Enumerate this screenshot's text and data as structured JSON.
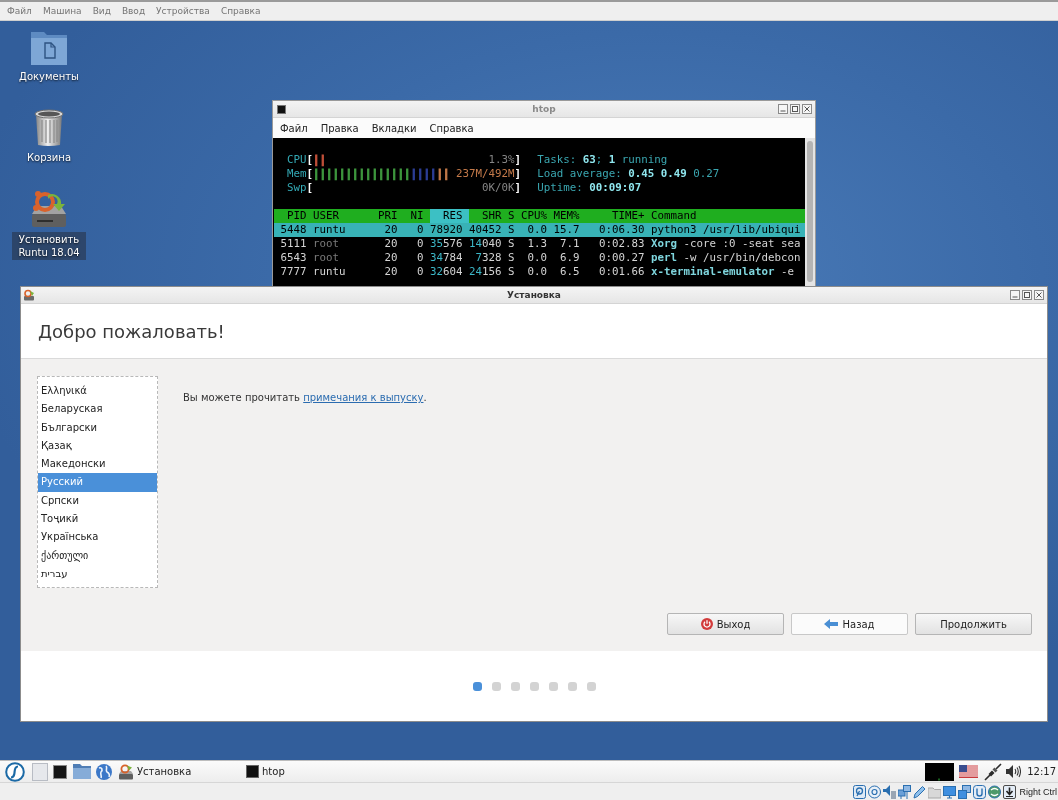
{
  "vm_menu": [
    "Файл",
    "Машина",
    "Вид",
    "Ввод",
    "Устройства",
    "Справка"
  ],
  "desktop_icons": [
    {
      "kind": "folder",
      "label": "Документы",
      "selected": false
    },
    {
      "kind": "trash",
      "label": "Корзина",
      "selected": false
    },
    {
      "kind": "installer",
      "label": "Установить Runtu 18.04",
      "selected": true
    }
  ],
  "htop": {
    "title": "htop",
    "menu": [
      "Файл",
      "Правка",
      "Вкладки",
      "Справка"
    ],
    "meters": [
      {
        "label": "CPU",
        "open": "[",
        "segments": [
          {
            "text": "||",
            "color": "#c4513a"
          }
        ],
        "value": {
          "text": "1.3%",
          "color": "#858585"
        },
        "close": "]"
      },
      {
        "label": "Mem",
        "open": "[",
        "segments": [
          {
            "text": "|||||||||||||||",
            "color": "#3f9a3f"
          },
          {
            "text": "||||",
            "color": "#2d3f99"
          },
          {
            "text": "||",
            "color": "#c47a4a"
          }
        ],
        "value": {
          "text": "237M/492M",
          "color": "#c47a4a"
        },
        "close": "]"
      },
      {
        "label": "Swp",
        "open": "[",
        "value": {
          "text": "0K/0K",
          "color": "#858585"
        },
        "close": "]"
      }
    ],
    "summary": [
      "Tasks: **63**; **1** running",
      "Load average: **0.45** **0.49** 0.27",
      "Uptime: **00:09:07**"
    ],
    "columns": [
      {
        "label": "PID",
        "selected": false
      },
      {
        "label": "USER",
        "selected": false
      },
      {
        "label": "PRI",
        "selected": false
      },
      {
        "label": "NI",
        "selected": false
      },
      {
        "label": "RES",
        "selected": true
      },
      {
        "label": "SHR",
        "selected": false
      },
      {
        "label": "S",
        "selected": false
      },
      {
        "label": "CPU%",
        "selected": false
      },
      {
        "label": "MEM%",
        "selected": false
      },
      {
        "label": "TIME+",
        "selected": false
      },
      {
        "label": "Command",
        "selected": false
      }
    ],
    "rows": [
      {
        "cells": [
          "5448",
          "runtu",
          "20",
          "0",
          "78920",
          "40452",
          "S",
          "0.0",
          "15.7",
          "0:06.30",
          "python3 /usr/lib/ubiqui"
        ],
        "user_muted": false,
        "selected": true
      },
      {
        "cells": [
          "5111",
          "root",
          "20",
          "0",
          "35576",
          "14040",
          "S",
          "1.3",
          "7.1",
          "0:02.83",
          "Xorg -core :0 -seat sea"
        ],
        "user_muted": true,
        "selected": false
      },
      {
        "cells": [
          "6543",
          "root",
          "20",
          "0",
          "34784",
          "7328",
          "S",
          "0.0",
          "6.9",
          "0:00.27",
          "perl -w /usr/bin/debcon"
        ],
        "user_muted": true,
        "selected": false
      },
      {
        "cells": [
          "7777",
          "runtu",
          "20",
          "0",
          "32604",
          "24156",
          "S",
          "0.0",
          "6.5",
          "0:01.66",
          "x-terminal-emulator -e"
        ],
        "user_muted": false,
        "selected": false
      }
    ]
  },
  "installer": {
    "title": "Установка",
    "heading": "Добро пожаловать!",
    "languages": [
      {
        "label": "Ελληνικά",
        "selected": false
      },
      {
        "label": "Беларуская",
        "selected": false
      },
      {
        "label": "Български",
        "selected": false
      },
      {
        "label": "Қазақ",
        "selected": false
      },
      {
        "label": "Македонски",
        "selected": false
      },
      {
        "label": "Русский",
        "selected": true
      },
      {
        "label": "Српски",
        "selected": false
      },
      {
        "label": "Тоҷикӣ",
        "selected": false
      },
      {
        "label": "Українська",
        "selected": false
      },
      {
        "label": "ქართული",
        "selected": false
      },
      {
        "label": "עברית",
        "selected": false
      }
    ],
    "notes": {
      "before": "Вы можете прочитать ",
      "link": "примечания к выпуску",
      "after": "."
    },
    "buttons": [
      {
        "kind": "quit",
        "label": "Выход",
        "hovered": false
      },
      {
        "kind": "back",
        "label": "Назад",
        "hovered": true
      },
      {
        "kind": "continue",
        "label": "Продолжить",
        "hovered": false
      }
    ],
    "steps": [
      {
        "selected": true
      },
      {
        "selected": false
      },
      {
        "selected": false
      },
      {
        "selected": false
      },
      {
        "selected": false
      },
      {
        "selected": false
      },
      {
        "selected": false
      }
    ]
  },
  "taskbar": {
    "tasks": [
      {
        "kind": "installer",
        "label": "Установка"
      },
      {
        "kind": "terminal",
        "label": "htop"
      }
    ],
    "clock": "12:17"
  },
  "vm_status": {
    "host_key": "Right Ctrl"
  }
}
